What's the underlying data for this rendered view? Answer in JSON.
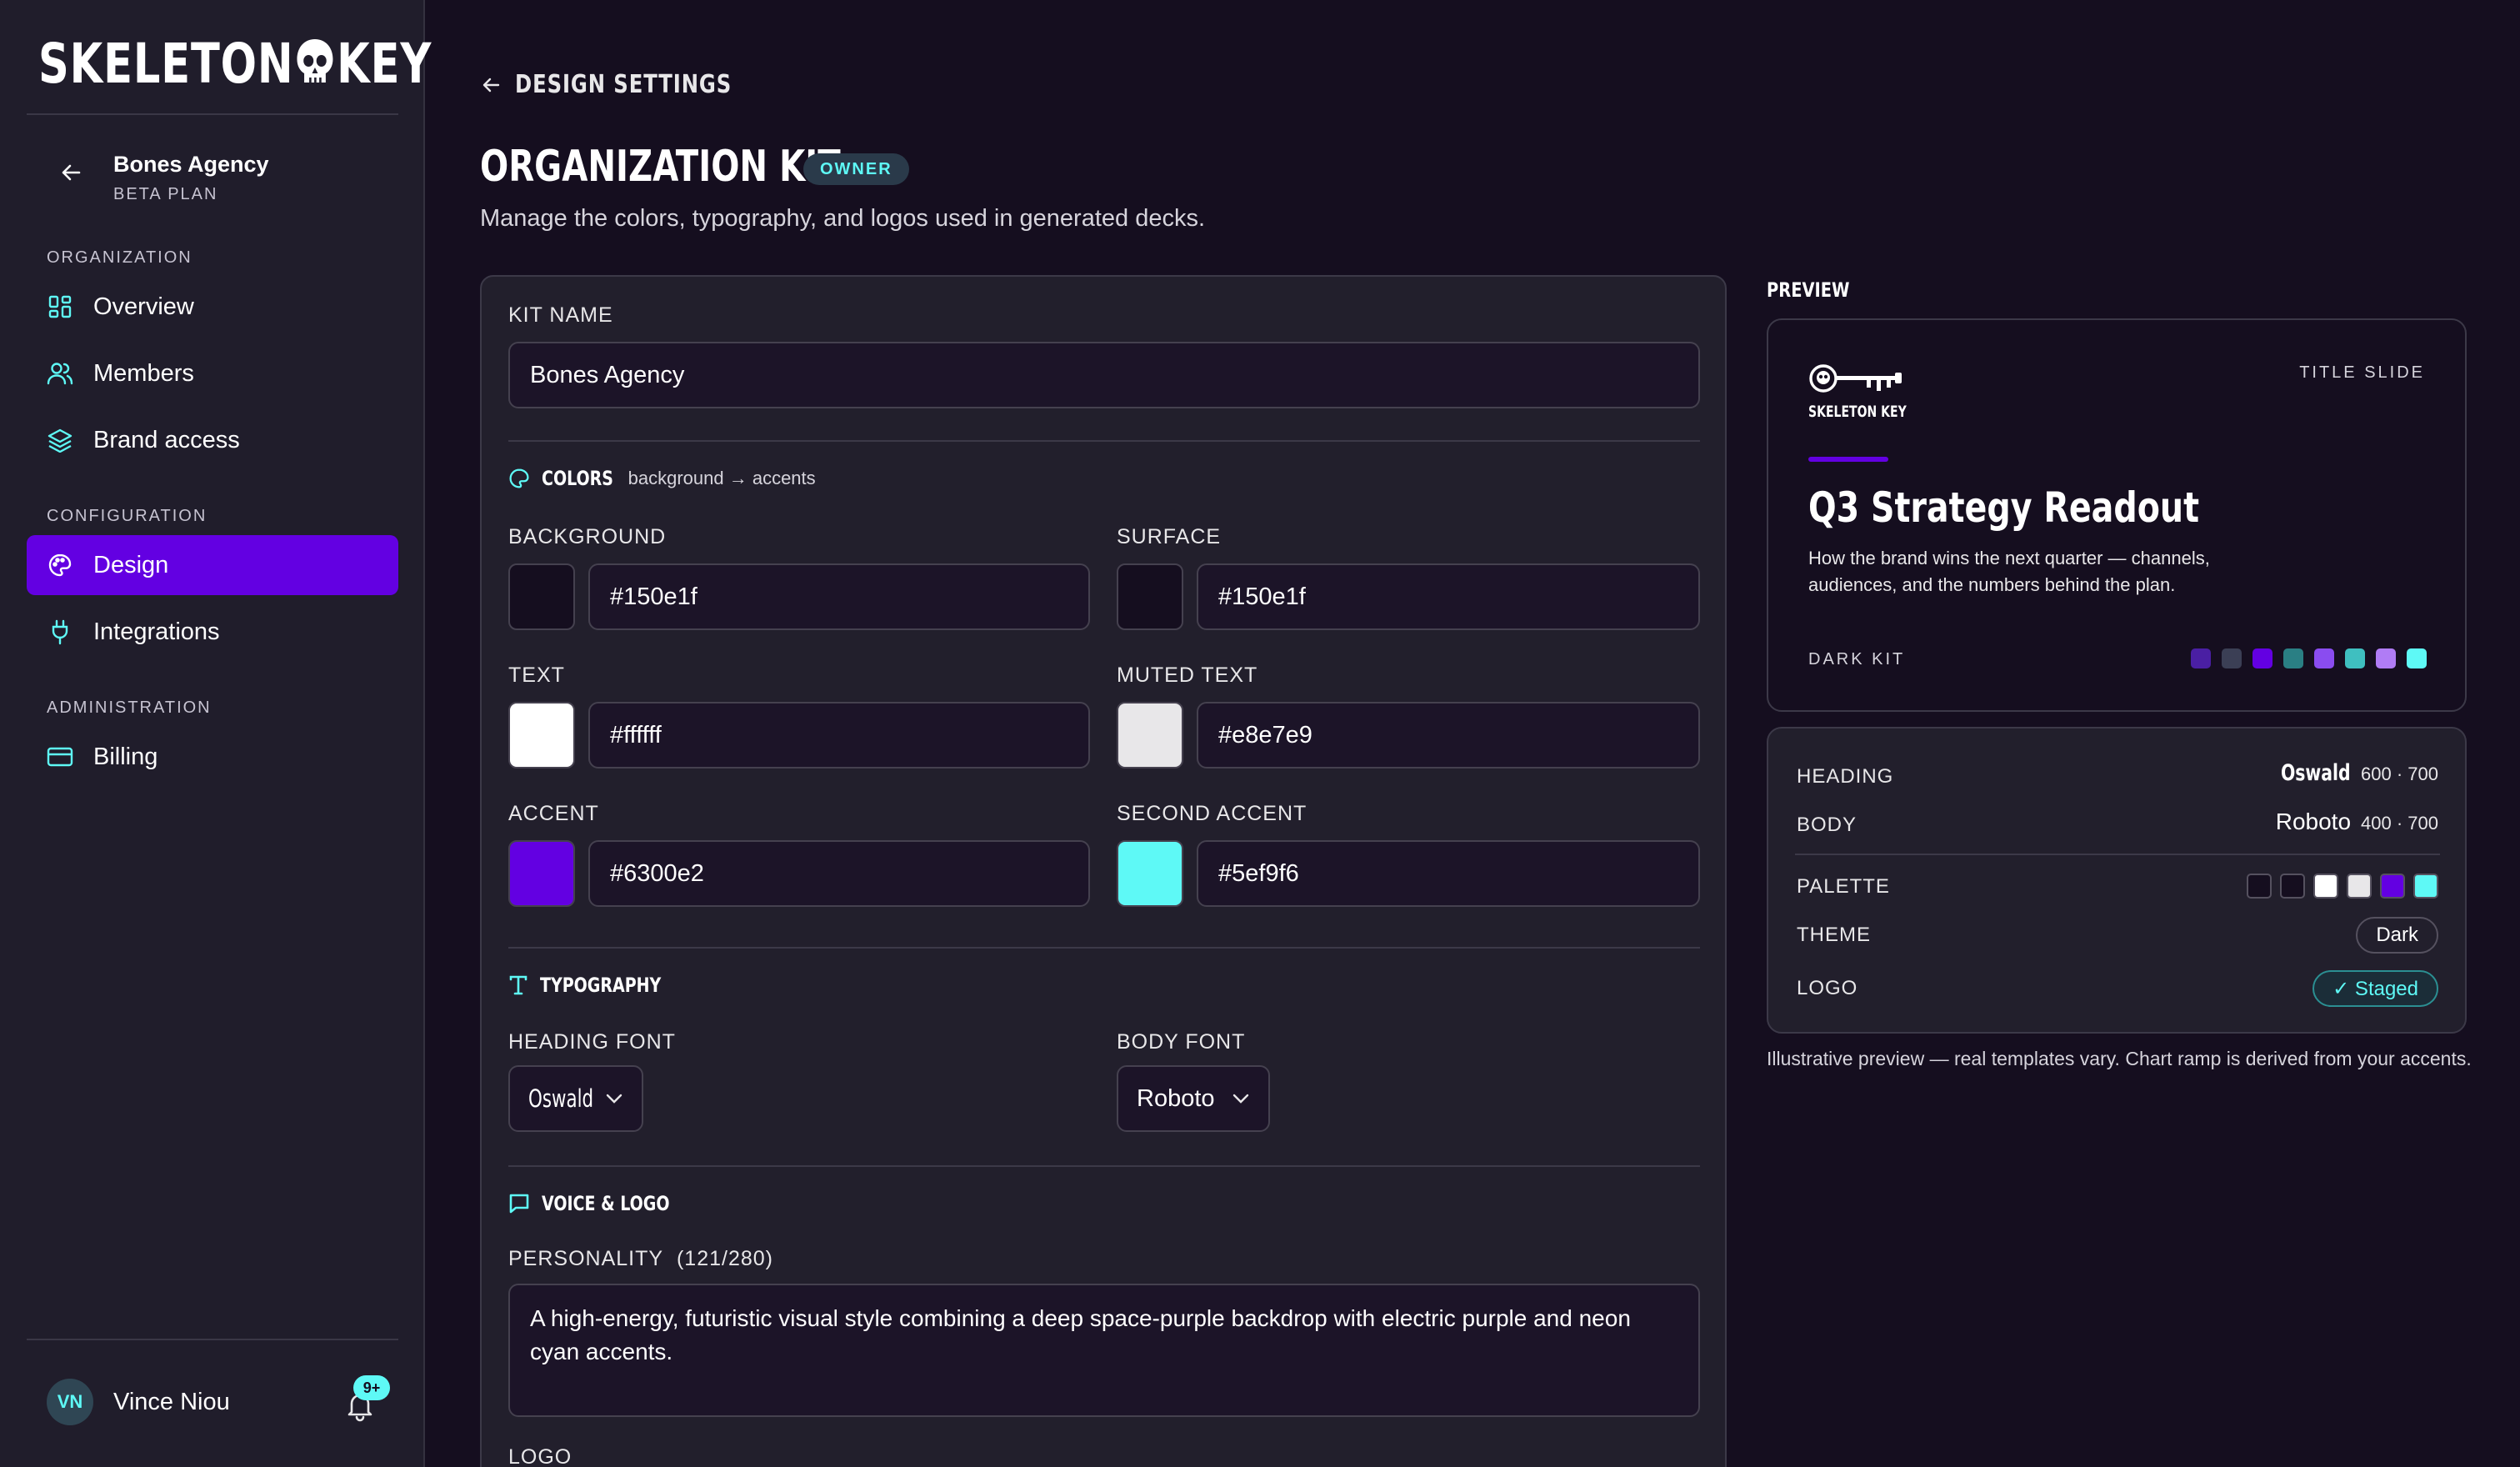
{
  "app": {
    "logo_text_left": "SKELETON",
    "logo_text_right": "KEY"
  },
  "sidebar": {
    "org_name": "Bones Agency",
    "org_plan": "BETA PLAN",
    "sections": {
      "organization": "ORGANIZATION",
      "configuration": "CONFIGURATION",
      "administration": "ADMINISTRATION"
    },
    "items": [
      {
        "label": "Overview",
        "icon": "grid-icon",
        "active": false
      },
      {
        "label": "Members",
        "icon": "users-icon",
        "active": false
      },
      {
        "label": "Brand access",
        "icon": "layers-icon",
        "active": false
      },
      {
        "label": "Design",
        "icon": "palette-icon",
        "active": true
      },
      {
        "label": "Integrations",
        "icon": "plug-icon",
        "active": false
      },
      {
        "label": "Billing",
        "icon": "card-icon",
        "active": false
      }
    ],
    "user": {
      "initials": "VN",
      "name": "Vince Niou",
      "notifications": "9+"
    }
  },
  "header": {
    "breadcrumb": "DESIGN SETTINGS",
    "title": "ORGANIZATION KIT",
    "badge": "OWNER",
    "subtitle": "Manage the colors, typography, and logos used in generated decks."
  },
  "form": {
    "kit_name": {
      "label": "KIT NAME",
      "value": "Bones Agency"
    },
    "colors": {
      "heading": "COLORS",
      "hint": "background → accents",
      "fields": [
        {
          "label": "BACKGROUND",
          "value": "#150e1f"
        },
        {
          "label": "SURFACE",
          "value": "#150e1f"
        },
        {
          "label": "TEXT",
          "value": "#ffffff"
        },
        {
          "label": "MUTED TEXT",
          "value": "#e8e7e9"
        },
        {
          "label": "ACCENT",
          "value": "#6300e2"
        },
        {
          "label": "SECOND ACCENT",
          "value": "#5ef9f6"
        }
      ]
    },
    "typography": {
      "heading": "TYPOGRAPHY",
      "heading_font_label": "HEADING FONT",
      "heading_font": "Oswald",
      "body_font_label": "BODY FONT",
      "body_font": "Roboto"
    },
    "voice": {
      "heading": "VOICE & LOGO",
      "personality_label": "PERSONALITY",
      "personality_count": "(121/280)",
      "personality": "A high-energy, futuristic visual style combining a deep space-purple backdrop with electric purple and neon cyan accents.",
      "logo_label": "LOGO"
    }
  },
  "preview": {
    "label": "PREVIEW",
    "slide": {
      "logo_text": "SKELETON KEY",
      "tag": "TITLE SLIDE",
      "title": "Q3 Strategy Readout",
      "body": "How the brand wins the next quarter — channels, audiences, and the numbers behind the plan.",
      "kit": "DARK KIT",
      "ramp": [
        "#4a1fa3",
        "#3b3f55",
        "#6300e2",
        "#2a7f84",
        "#8a4cf0",
        "#3fbfc0",
        "#b07cf5",
        "#5ef9f6"
      ]
    },
    "specs": {
      "heading_label": "HEADING",
      "heading_font": "Oswald",
      "heading_weights": "600 · 700",
      "body_label": "BODY",
      "body_font": "Roboto",
      "body_weights": "400 · 700",
      "palette_label": "PALETTE",
      "palette": [
        "#150e1f",
        "#150e1f",
        "#ffffff",
        "#e8e7e9",
        "#6300e2",
        "#5ef9f6"
      ],
      "theme_label": "THEME",
      "theme": "Dark",
      "logo_label": "LOGO",
      "logo_status": "✓ Staged"
    },
    "note": "Illustrative preview — real templates vary. Chart ramp is derived from your accents."
  }
}
